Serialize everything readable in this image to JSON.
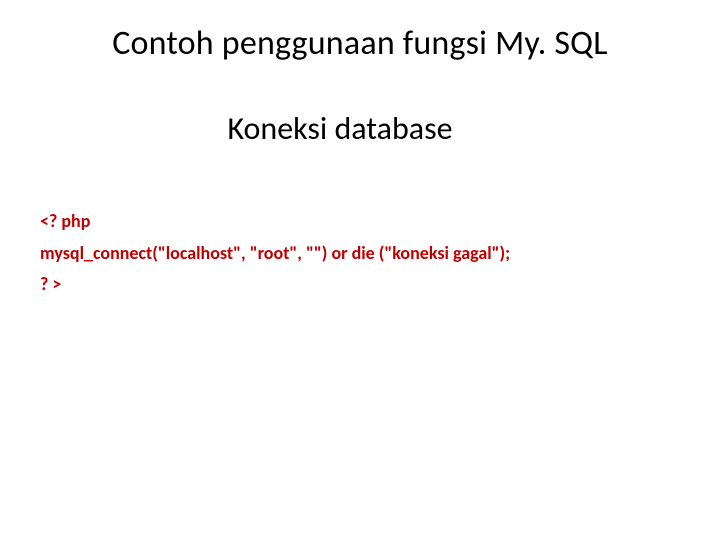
{
  "title": "Contoh penggunaan fungsi My. SQL",
  "subtitle": "Koneksi database",
  "code": {
    "line1": "<? php",
    "line2": "mysql_connect(\"localhost\", \"root\", \"\") or die (\"koneksi gagal\");",
    "line3": "? >"
  }
}
